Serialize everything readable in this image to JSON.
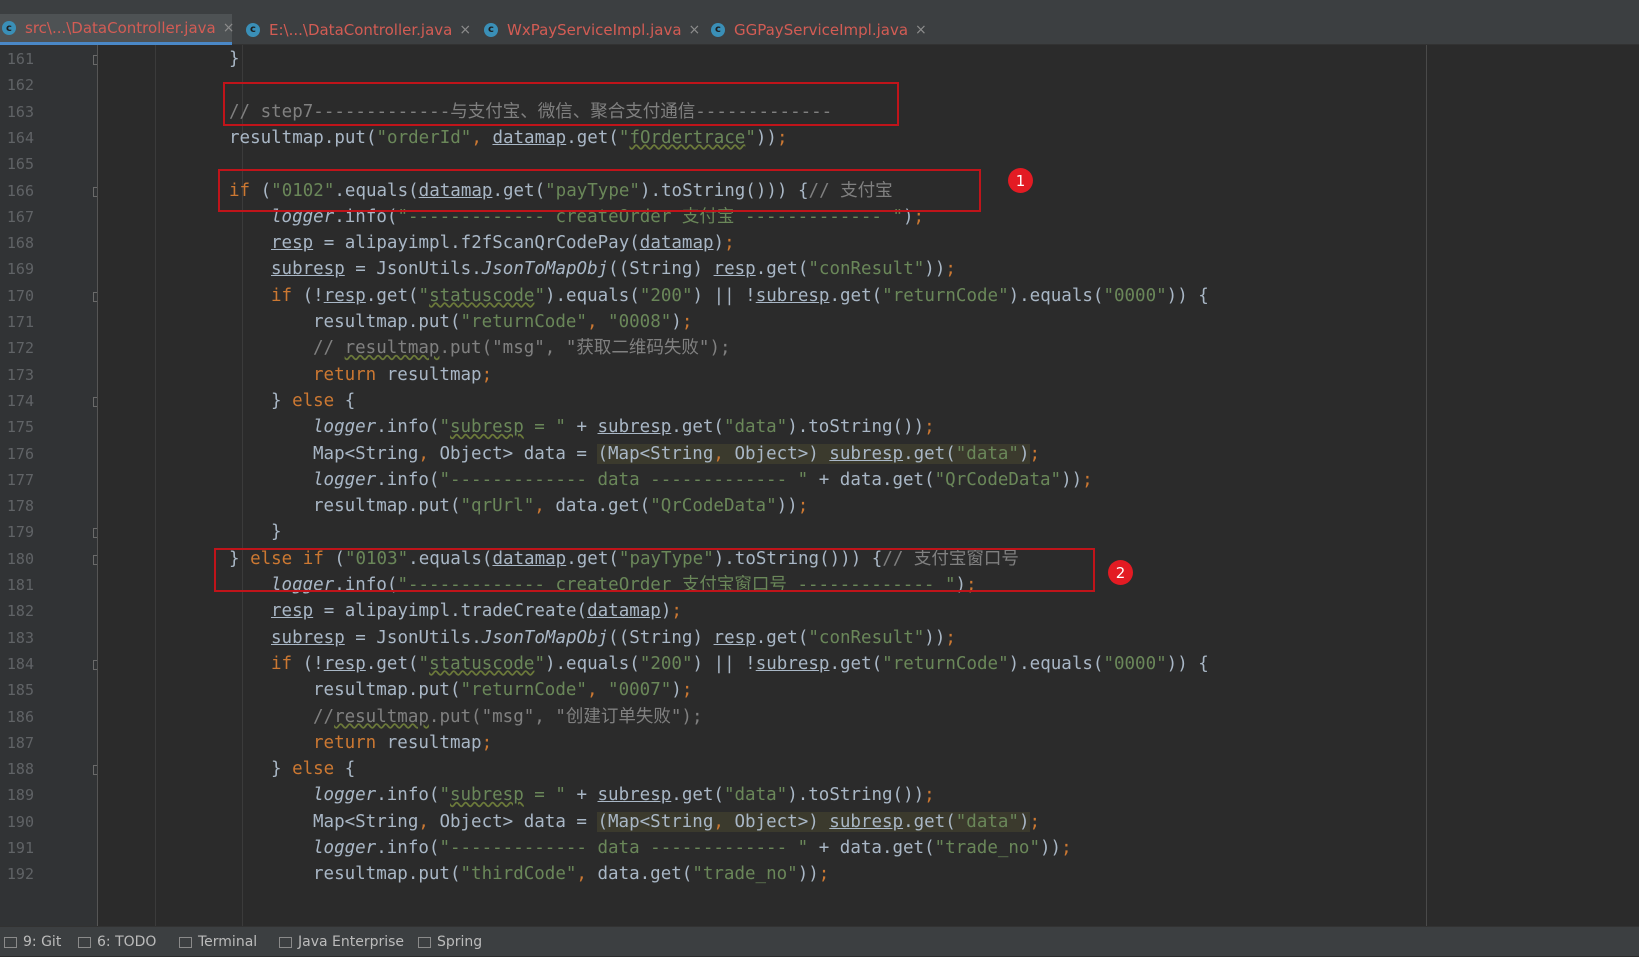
{
  "tabs": [
    {
      "label": "src\\...\\DataController.java",
      "active": true
    },
    {
      "label": "E:\\...\\DataController.java",
      "active": false
    },
    {
      "label": "WxPayServiceImpl.java",
      "active": false
    },
    {
      "label": "GGPayServiceImpl.java",
      "active": false
    }
  ],
  "tab_icon_glyph": "c",
  "tab_close_glyph": "×",
  "line_numbers": [
    "161",
    "162",
    "163",
    "164",
    "165",
    "166",
    "167",
    "168",
    "169",
    "170",
    "171",
    "172",
    "173",
    "174",
    "175",
    "176",
    "177",
    "178",
    "179",
    "180",
    "181",
    "182",
    "183",
    "184",
    "185",
    "186",
    "187",
    "188",
    "189",
    "190",
    "191",
    "192"
  ],
  "code_lines": [
    "}",
    "",
    "// step7-------------与支付宝、微信、聚合支付通信-------------",
    "resultmap.put(\"orderId\", datamap.get(\"fOrdertrace\"));",
    "",
    "if (\"0102\".equals(datamap.get(\"payType\").toString())) {// 支付宝",
    "    logger.info(\"------------- createOrder 支付宝 ------------- \");",
    "    resp = alipayimpl.f2fScanQrCodePay(datamap);",
    "    subresp = JsonUtils.JsonToMapObj((String) resp.get(\"conResult\"));",
    "    if (!resp.get(\"statuscode\").equals(\"200\") || !subresp.get(\"returnCode\").equals(\"0000\")) {",
    "        resultmap.put(\"returnCode\", \"0008\");",
    "        // resultmap.put(\"msg\", \"获取二维码失败\");",
    "        return resultmap;",
    "    } else {",
    "        logger.info(\"subresp = \" + subresp.get(\"data\").toString());",
    "        Map<String, Object> data = (Map<String, Object>) subresp.get(\"data\");",
    "        logger.info(\"------------- data ------------- \" + data.get(\"QrCodeData\"));",
    "        resultmap.put(\"qrUrl\", data.get(\"QrCodeData\"));",
    "    }",
    "} else if (\"0103\".equals(datamap.get(\"payType\").toString())) {// 支付宝窗口号",
    "    logger.info(\"------------- createOrder 支付宝窗口号 ------------- \");",
    "    resp = alipayimpl.tradeCreate(datamap);",
    "    subresp = JsonUtils.JsonToMapObj((String) resp.get(\"conResult\"));",
    "    if (!resp.get(\"statuscode\").equals(\"200\") || !subresp.get(\"returnCode\").equals(\"0000\")) {",
    "        resultmap.put(\"returnCode\", \"0007\");",
    "        //resultmap.put(\"msg\", \"创建订单失败\");",
    "        return resultmap;",
    "    } else {",
    "        logger.info(\"subresp = \" + subresp.get(\"data\").toString());",
    "        Map<String, Object> data = (Map<String, Object>) subresp.get(\"data\");",
    "        logger.info(\"------------- data ------------- \" + data.get(\"trade_no\"));",
    "        resultmap.put(\"thirdCode\", data.get(\"trade_no\"));"
  ],
  "annotations": [
    {
      "label": "1"
    },
    {
      "label": "2"
    }
  ],
  "bottom_tools": [
    {
      "label": "9: Git",
      "icon": "git-icon"
    },
    {
      "label": "6: TODO",
      "icon": "todo-list-icon"
    },
    {
      "label": "Terminal",
      "icon": "terminal-icon"
    },
    {
      "label": "Java Enterprise",
      "icon": "java-enterprise-icon"
    },
    {
      "label": "Spring",
      "icon": "spring-leaf-icon"
    }
  ],
  "colors": {
    "editor_background": "#2b2b2b",
    "keyword": "#cc7832",
    "string": "#6a8759",
    "comment": "#808080",
    "default_text": "#a9b7c6",
    "annotation_box": "#c0141a",
    "annotation_badge": "#e31b23",
    "modified_tab_text": "#d35c54"
  }
}
